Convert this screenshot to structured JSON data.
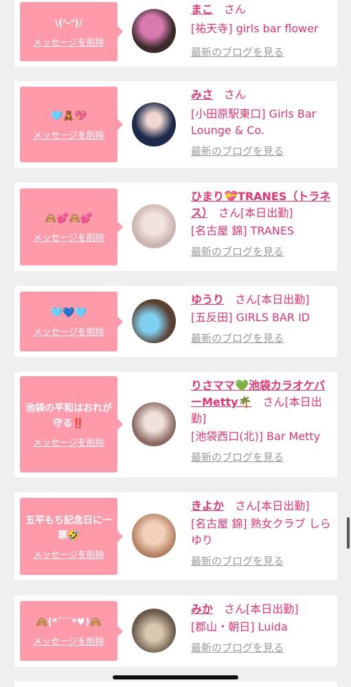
{
  "entries": [
    {
      "message": "\\(ᐢ-ᐢ)/",
      "delete": "メッセージを削除",
      "name": "まこ",
      "san": "さん",
      "status": "",
      "shop": "[祐天寺] girls bar flower",
      "blog": "最新のブログを見る",
      "avatar_colors": [
        "#3a2a2a",
        "#d87ab0"
      ]
    },
    {
      "message": "🩵🧸💖",
      "delete": "メッセージを削除",
      "name": "みさ",
      "san": "さん",
      "status": "",
      "shop": "[小田原駅東口] Girls Bar Lounge & Co.",
      "blog": "最新のブログを見る",
      "avatar_colors": [
        "#1e2a4a",
        "#6b4a7a"
      ]
    },
    {
      "message": "🙈💕🙈💕",
      "delete": "メッセージを削除",
      "name": "ひまり💝TRANES（トラネス）",
      "san": "さん",
      "status": "[本日出勤]",
      "shop": "[名古屋 錦] TRANES",
      "blog": "最新のブログを見る",
      "avatar_colors": [
        "#e8d8d4",
        "#c9b3ae"
      ]
    },
    {
      "message": "🩵💙🩵",
      "delete": "メッセージを削除",
      "name": "ゆうり",
      "san": "さん",
      "status": "[本日出勤]",
      "shop": "[五反田] GIRLS BAR ID",
      "blog": "最新のブログを見る",
      "avatar_colors": [
        "#5a4030",
        "#7fd0f0"
      ]
    },
    {
      "message": "池袋の平和はおれが守る‼️",
      "delete": "メッセージを削除",
      "name": "りさママ💚池袋カラオケバーMetty🌴",
      "san": "さん",
      "status": "[本日出勤]",
      "shop": "[池袋西口(北)] Bar Metty",
      "blog": "最新のブログを見る",
      "avatar_colors": [
        "#cfa596",
        "#8a6a62"
      ]
    },
    {
      "message": "五平もち記念日に一票🤣",
      "delete": "メッセージを削除",
      "name": "きよか",
      "san": "さん",
      "status": "[本日出勤]",
      "shop": "[名古屋 錦] 熟女クラブ しらゆり",
      "blog": "最新のブログを見る",
      "avatar_colors": [
        "#e8c0a8",
        "#b07a5a"
      ]
    },
    {
      "message": "🙈(*´˘`*♥)🙈",
      "delete": "メッセージを削除",
      "name": "みか",
      "san": "さん",
      "status": "[本日出勤]",
      "shop": "[郡山・朝日] Luida",
      "blog": "最新のブログを見る",
      "avatar_colors": [
        "#6a5a4a",
        "#d8c8b0"
      ]
    }
  ]
}
